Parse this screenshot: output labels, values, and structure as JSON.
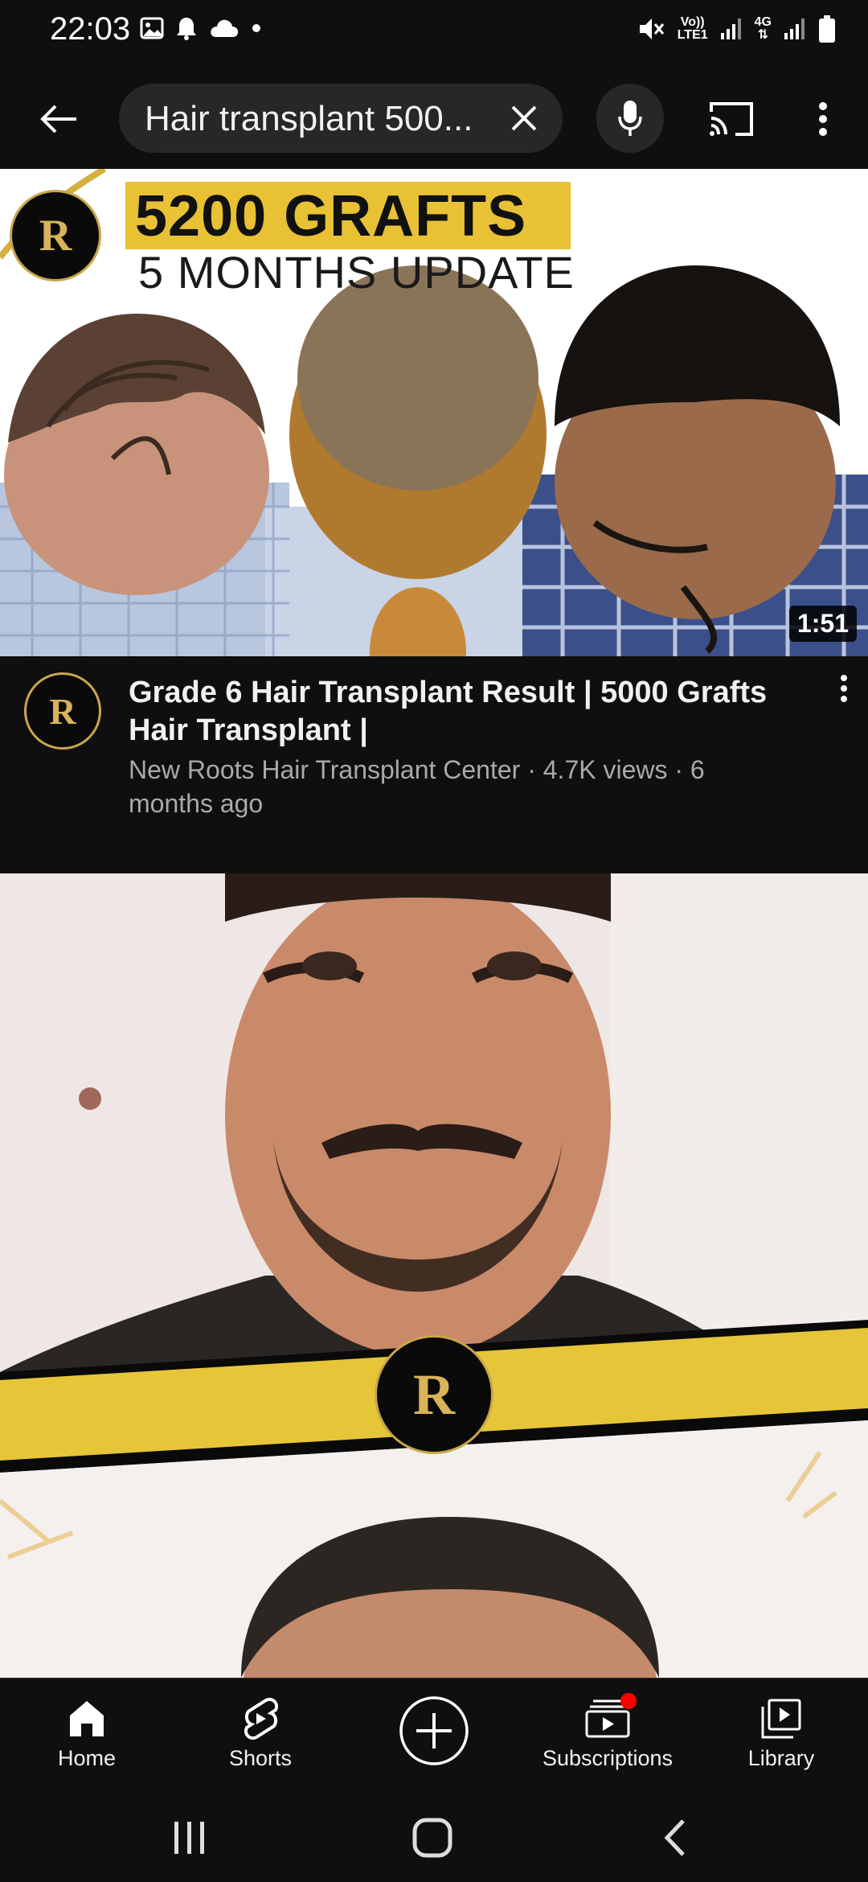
{
  "status_bar": {
    "time": "22:03",
    "network_top": "Vo))",
    "network_bottom": "LTE1",
    "network_type": "4G",
    "icons": [
      "gallery-icon",
      "bell-icon",
      "cloud-icon",
      "dot-icon",
      "mute-icon",
      "signal-icon",
      "battery-icon"
    ]
  },
  "header": {
    "search_query": "Hair transplant 500...",
    "icons": [
      "back-arrow-icon",
      "close-icon",
      "mic-icon",
      "cast-icon",
      "more-vert-icon"
    ]
  },
  "videos": [
    {
      "thumbnail": {
        "headline": "5200 GRAFTS",
        "subheadline": "5 MONTHS UPDATE",
        "logo": "R",
        "duration": "1:51"
      },
      "title": "Grade 6 Hair Transplant Result | 5000 Grafts Hair Transplant |",
      "channel": "New Roots Hair Transplant Center",
      "views": "4.7K views",
      "age": "6 months ago",
      "subtitle": "New Roots Hair Transplant Center · 4.7K views · 6 months ago",
      "avatar_logo": "R"
    },
    {
      "thumbnail": {
        "logo": "R"
      }
    }
  ],
  "bottom_nav": {
    "items": [
      {
        "label": "Home",
        "icon": "home-icon"
      },
      {
        "label": "Shorts",
        "icon": "shorts-icon"
      },
      {
        "label": "",
        "icon": "create-icon"
      },
      {
        "label": "Subscriptions",
        "icon": "subscriptions-icon",
        "badge": true
      },
      {
        "label": "Library",
        "icon": "library-icon"
      }
    ]
  },
  "colors": {
    "background": "#0f0f0f",
    "pill": "#272727",
    "accent_yellow": "#e8c234",
    "secondary_text": "#aaaaaa",
    "notification_red": "#ff0000"
  }
}
